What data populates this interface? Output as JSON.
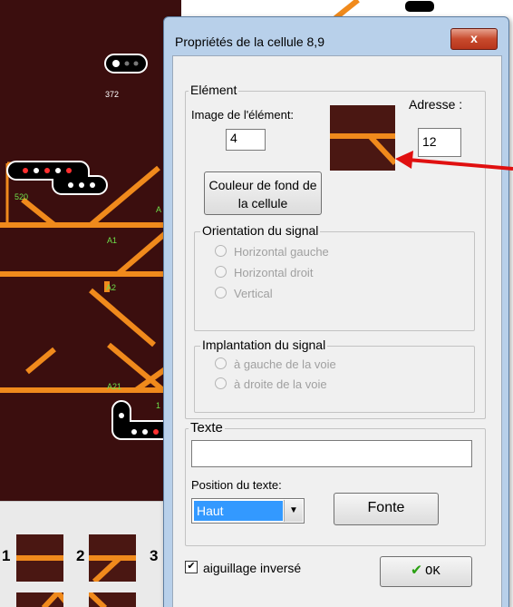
{
  "track": {
    "labels": [
      "372",
      "520",
      "A1",
      "A2",
      "A21",
      "A",
      "1"
    ]
  },
  "palette": {
    "numbers": [
      "1",
      "2",
      "3"
    ]
  },
  "dialog": {
    "title": "Propriétés de la cellule 8,9",
    "close_label": "x",
    "element_group": {
      "legend": "Elément",
      "image_label": "Image de l'élément:",
      "image_value": "4",
      "address_label": "Adresse :",
      "address_value": "12",
      "bg_button": "Couleur de fond de la cellule"
    },
    "orientation": {
      "legend": "Orientation du signal",
      "options": [
        "Horizontal gauche",
        "Horizontal droit",
        "Vertical"
      ]
    },
    "implantation": {
      "legend": "Implantation du signal",
      "options": [
        "à gauche de la voie",
        "à droite de la voie"
      ]
    },
    "text_group": {
      "legend": "Texte",
      "value": "",
      "position_label": "Position du texte:",
      "position_value": "Haut",
      "font_button": "Fonte"
    },
    "inverted_switch": {
      "label": "aiguillage inversé",
      "checked": true
    },
    "ok_button": "OK"
  },
  "colors": {
    "track_bg": "#3b0e0e",
    "rail": "#f08a1c",
    "dialog_frame": "#b8d0ea",
    "arrow": "#e01010"
  }
}
